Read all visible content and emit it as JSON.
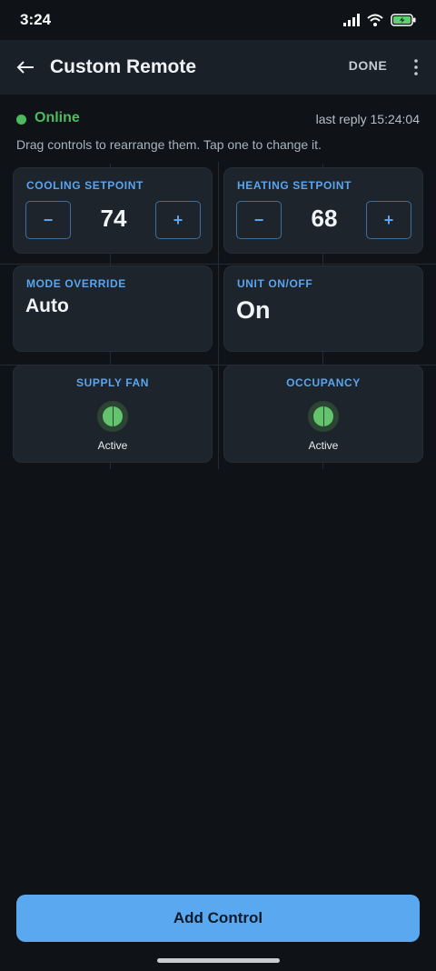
{
  "status_bar": {
    "time": "3:24"
  },
  "app_bar": {
    "title": "Custom Remote",
    "done_label": "DONE"
  },
  "connection": {
    "status": "Online",
    "last_reply": "last reply 15:24:04"
  },
  "hint": "Drag controls to rearrange them. Tap one to change it.",
  "controls": {
    "cooling": {
      "label": "COOLING SETPOINT",
      "value": "74",
      "minus": "−",
      "plus": "+"
    },
    "heating": {
      "label": "HEATING SETPOINT",
      "value": "68",
      "minus": "−",
      "plus": "+"
    },
    "mode": {
      "label": "MODE OVERRIDE",
      "value": "Auto"
    },
    "unit": {
      "label": "UNIT ON/OFF",
      "value": "On"
    },
    "fan": {
      "label": "SUPPLY FAN",
      "state": "Active"
    },
    "occupancy": {
      "label": "OCCUPANCY",
      "state": "Active"
    }
  },
  "add_control_label": "Add Control",
  "colors": {
    "accent": "#5aa5f0",
    "online": "#4cbb5e",
    "background": "#0f1318",
    "card": "#1d242c"
  }
}
